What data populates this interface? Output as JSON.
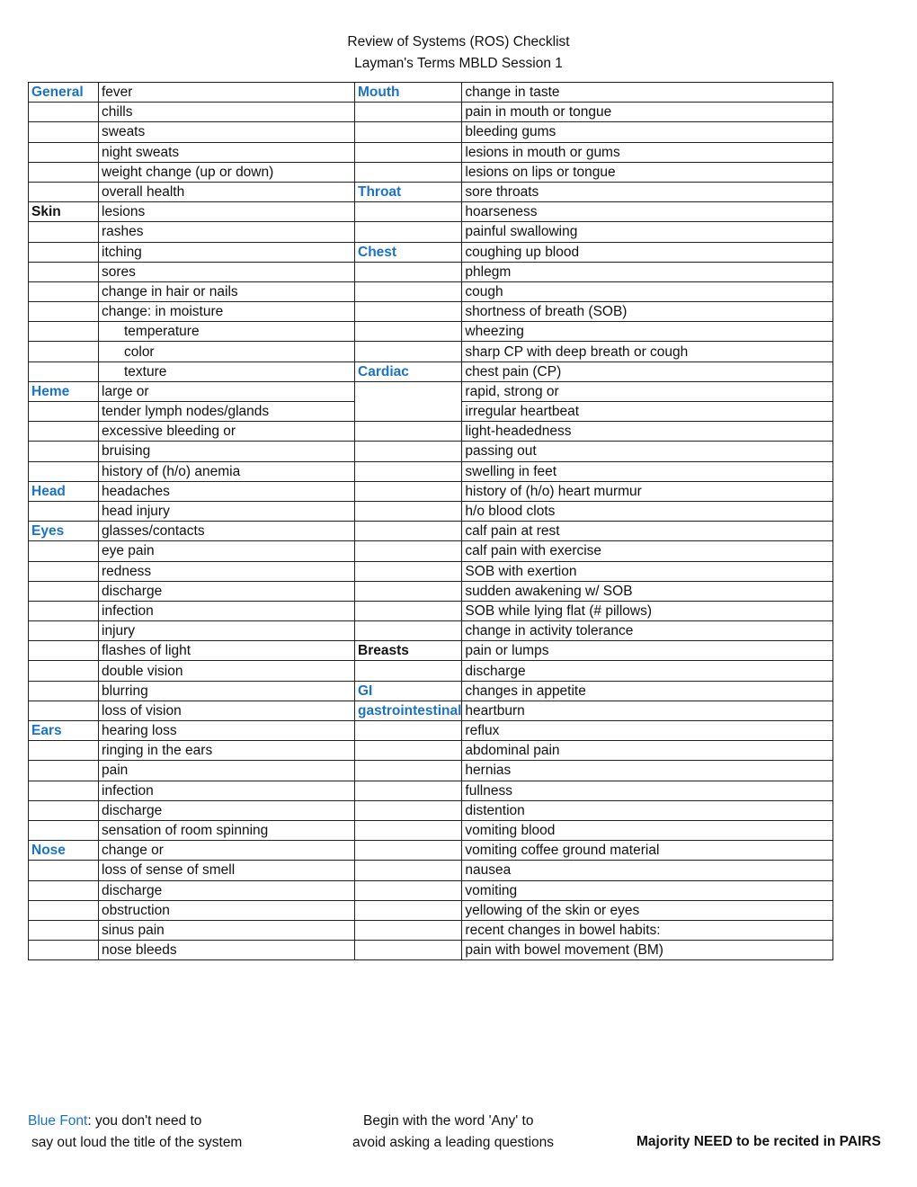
{
  "document": {
    "title": "Review of Systems (ROS) Checklist",
    "subtitle": "Layman's Terms MBLD Session 1"
  },
  "rows": [
    {
      "sys_left": "General",
      "left": "fever",
      "sys_right": "Mouth",
      "right": "change in taste"
    },
    {
      "sys_left": "",
      "left": "chills",
      "sys_right": "",
      "right": "pain in mouth or tongue"
    },
    {
      "sys_left": "",
      "left": "sweats",
      "sys_right": "",
      "right": "bleeding gums"
    },
    {
      "sys_left": "",
      "left": "night sweats",
      "sys_right": "",
      "right": "lesions in mouth or gums"
    },
    {
      "sys_left": "",
      "left": "weight change (up or down)",
      "sys_right": "",
      "right": "lesions on lips or tongue"
    },
    {
      "sys_left": "",
      "left": "overall health",
      "sys_right": "Throat",
      "right": "sore throats"
    },
    {
      "sys_left": "Skin",
      "left": "lesions",
      "sys_right": "",
      "right": "hoarseness"
    },
    {
      "sys_left": "",
      "left": "rashes",
      "sys_right": "",
      "right": "painful swallowing"
    },
    {
      "sys_left": "",
      "left": "itching",
      "sys_right": "Chest",
      "right": "coughing up blood"
    },
    {
      "sys_left": "",
      "left": "sores",
      "sys_right": "",
      "right": "phlegm"
    },
    {
      "sys_left": "",
      "left": "change in hair or nails",
      "sys_right": "",
      "right": "cough"
    },
    {
      "sys_left": "",
      "left": "change: in moisture",
      "sys_right": "",
      "right": "shortness of breath (SOB)"
    },
    {
      "sys_left": "",
      "left": "temperature",
      "sys_right": "",
      "right": "wheezing"
    },
    {
      "sys_left": "",
      "left": "color",
      "sys_right": "",
      "right": "sharp CP with deep breath or cough"
    },
    {
      "sys_left": "",
      "left": "texture",
      "sys_right": "Cardiac",
      "right": "chest pain (CP)"
    },
    {
      "sys_left": "Heme",
      "left": "large  or",
      "sys_right": "",
      "right": "rapid, strong or"
    },
    {
      "sys_left": "",
      "left": "tender lymph nodes/glands",
      "sys_right": null,
      "right": "irregular heartbeat"
    },
    {
      "sys_left": "",
      "left": "excessive bleeding or",
      "sys_right": "",
      "right": "light-headedness"
    },
    {
      "sys_left": "",
      "left": "bruising",
      "sys_right": "",
      "right": "passing out"
    },
    {
      "sys_left": "",
      "left": "history of (h/o) anemia",
      "sys_right": "",
      "right": "swelling in feet"
    },
    {
      "sys_left": "Head",
      "left": "headaches",
      "sys_right": "",
      "right": "history of (h/o) heart murmur"
    },
    {
      "sys_left": "",
      "left": "head injury",
      "sys_right": "",
      "right": "h/o blood clots"
    },
    {
      "sys_left": "Eyes",
      "left": "glasses/contacts",
      "sys_right": "",
      "right": "calf pain at rest"
    },
    {
      "sys_left": "",
      "left": "eye pain",
      "sys_right": "",
      "right": "calf pain with exercise"
    },
    {
      "sys_left": "",
      "left": "redness",
      "sys_right": "",
      "right": "SOB with exertion"
    },
    {
      "sys_left": "",
      "left": "discharge",
      "sys_right": "",
      "right": "sudden awakening w/ SOB"
    },
    {
      "sys_left": "",
      "left": "infection",
      "sys_right": "",
      "right": "SOB while lying flat (# pillows)"
    },
    {
      "sys_left": "",
      "left": "injury",
      "sys_right": "",
      "right": "change in activity tolerance"
    },
    {
      "sys_left": "",
      "left": "flashes of light",
      "sys_right": "Breasts",
      "right": "pain or lumps"
    },
    {
      "sys_left": "",
      "left": "double vision",
      "sys_right": "",
      "right": "discharge"
    },
    {
      "sys_left": "",
      "left": "blurring",
      "sys_right": "GI",
      "right": "changes in appetite"
    },
    {
      "sys_left": "",
      "left": "loss of vision",
      "sys_right": "gastrointestinal",
      "right": "heartburn"
    },
    {
      "sys_left": "Ears",
      "left": "hearing loss",
      "sys_right": "",
      "right": "reflux"
    },
    {
      "sys_left": "",
      "left": "ringing in the ears",
      "sys_right": "",
      "right": "abdominal pain"
    },
    {
      "sys_left": "",
      "left": "pain",
      "sys_right": "",
      "right": "hernias"
    },
    {
      "sys_left": "",
      "left": "infection",
      "sys_right": "",
      "right": "fullness"
    },
    {
      "sys_left": "",
      "left": "discharge",
      "sys_right": "",
      "right": "distention"
    },
    {
      "sys_left": "",
      "left": "sensation of room spinning",
      "sys_right": "",
      "right": "vomiting blood"
    },
    {
      "sys_left": "Nose",
      "left": "change or",
      "sys_right": "",
      "right": "vomiting coffee ground material"
    },
    {
      "sys_left": "",
      "left": "loss of sense of smell",
      "sys_right": "",
      "right": "nausea"
    },
    {
      "sys_left": "",
      "left": "discharge",
      "sys_right": "",
      "right": "vomiting"
    },
    {
      "sys_left": "",
      "left": "obstruction",
      "sys_right": "",
      "right": "yellowing of the skin or eyes"
    },
    {
      "sys_left": "",
      "left": "sinus pain",
      "sys_right": "",
      "right": "recent changes in bowel habits:"
    },
    {
      "sys_left": "",
      "left": "nose bleeds",
      "sys_right": "",
      "right": "pain with bowel movement (BM)"
    }
  ],
  "style_hints": {
    "blue_systems": [
      "General",
      "Heme",
      "Head",
      "Eyes",
      "Ears",
      "Nose",
      "Mouth",
      "Throat",
      "Chest",
      "Cardiac",
      "GI",
      "gastrointestinal"
    ],
    "black_systems": [
      "Skin",
      "Breasts"
    ],
    "indented_items": [
      "temperature",
      "color",
      "texture"
    ],
    "blue_color": "#1a73c8"
  },
  "footer": {
    "note1_blue": "Blue Font",
    "note1_rest": ": you don't need to",
    "note1_line2": "say out loud the title of the system",
    "note2_line1": "Begin with the word 'Any' to",
    "note2_line2": "avoid asking a leading questions",
    "note3": "Majority NEED to be recited in PAIRS"
  }
}
